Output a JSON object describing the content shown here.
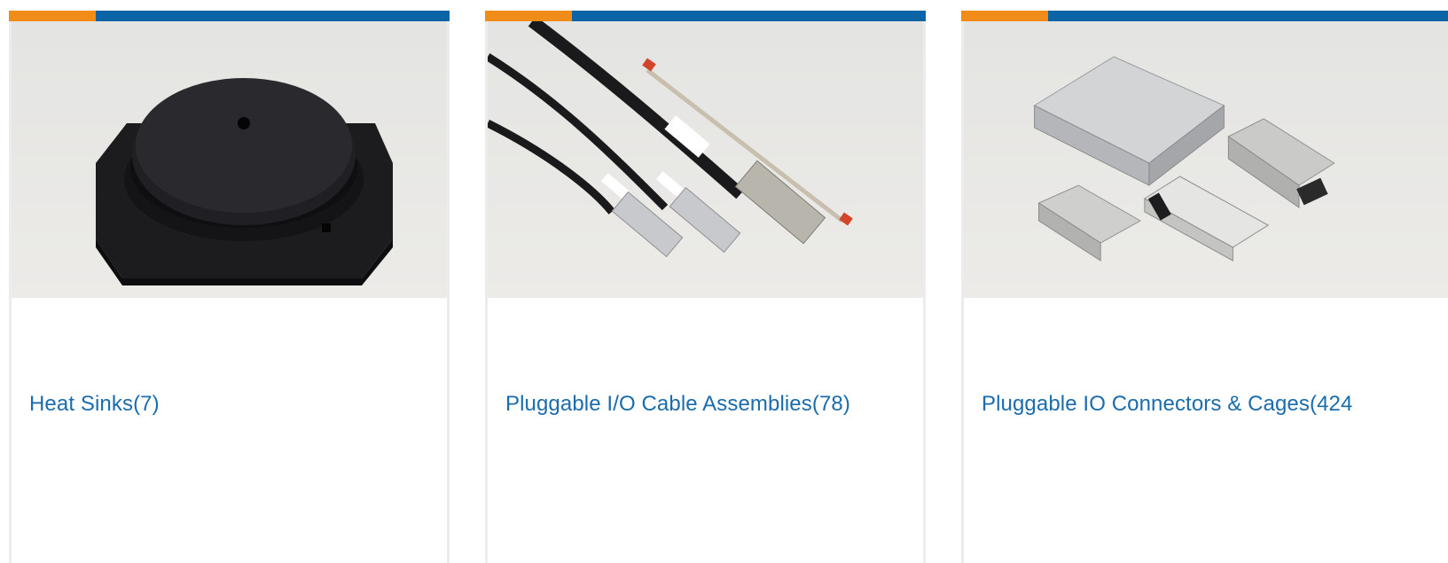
{
  "brand_colors": {
    "accent_orange": "#f28c18",
    "bar_blue": "#0a64a6",
    "link_blue": "#1a6cad"
  },
  "categories": [
    {
      "name": "Heat Sinks",
      "count": "(7)",
      "image_icon": "heat-sink-photo"
    },
    {
      "name": "Pluggable I/O Cable Assemblies",
      "count": "(78)",
      "image_icon": "cable-assembly-photo"
    },
    {
      "name": "Pluggable IO Connectors & Cages",
      "count": "(424",
      "image_icon": "connector-cage-photo"
    }
  ]
}
